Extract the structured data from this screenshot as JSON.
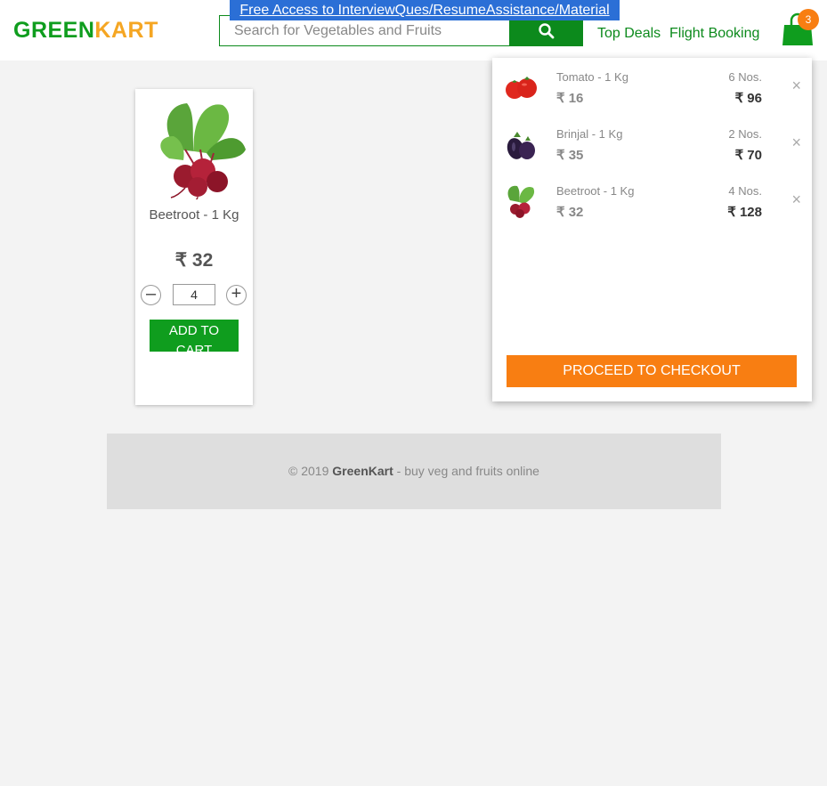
{
  "header": {
    "logo_green": "GREEN",
    "logo_orange": "KART",
    "promo_link": "Free Access to InterviewQues/ResumeAssistance/Material",
    "search": {
      "placeholder": "Search for Vegetables and Fruits",
      "value": ""
    },
    "nav": {
      "top_deals": "Top Deals",
      "flight_booking": "Flight Booking"
    },
    "cart_count": "3"
  },
  "product": {
    "name": "Beetroot - 1 Kg",
    "price": "₹ 32",
    "quantity": "4",
    "add_to_cart": "ADD TO CART",
    "decrement": "–",
    "increment": "+"
  },
  "cart_preview": {
    "items": [
      {
        "name": "Tomato - 1 Kg",
        "price": "₹ 16",
        "qty": "6 Nos.",
        "total": "₹ 96",
        "remove": "×"
      },
      {
        "name": "Brinjal - 1 Kg",
        "price": "₹ 35",
        "qty": "2 Nos.",
        "total": "₹ 70",
        "remove": "×"
      },
      {
        "name": "Beetroot - 1 Kg",
        "price": "₹ 32",
        "qty": "4 Nos.",
        "total": "₹ 128",
        "remove": "×"
      }
    ],
    "checkout_label": "PROCEED TO CHECKOUT"
  },
  "footer": {
    "prefix": "© 2019 ",
    "brand": "GreenKart",
    "suffix": " - buy veg and fruits online"
  },
  "colors": {
    "brand_green": "#0f9d1e",
    "brand_orange": "#f5a623",
    "cart_orange": "#f87e12",
    "promo_blue": "#2b6fd6"
  }
}
